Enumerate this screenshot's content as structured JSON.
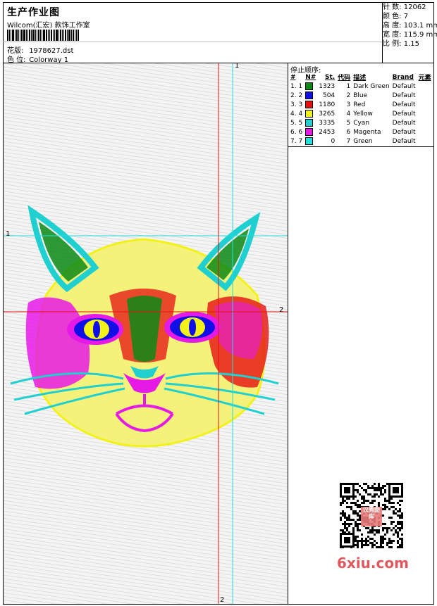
{
  "header": {
    "title": "生产作业图",
    "subtitle": "Wilcom(汇宏) 款饰工作室",
    "design_label": "花版:",
    "design_value": "1978627.dst",
    "colorway_label": "色 位:",
    "colorway_value": "Colorway 1"
  },
  "stats": {
    "stitches": "针 数:  12062",
    "colors": "颜 色:  7",
    "height": "高 度:  103.1 mm",
    "width": "宽 度:  115.9 mm",
    "scale": "比 例:  1.15"
  },
  "panel": {
    "title": "停止顺序:",
    "headers": [
      "#",
      "N#",
      "St.",
      "代码",
      "描述",
      "Brand",
      "元素"
    ],
    "rows": [
      {
        "idx": "1.",
        "n": "1",
        "color": "#0a8a14",
        "st": "1323",
        "code": "1",
        "desc": "Dark Green",
        "brand": "Default"
      },
      {
        "idx": "2.",
        "n": "2",
        "color": "#1010e6",
        "st": "504",
        "code": "2",
        "desc": "Blue",
        "brand": "Default"
      },
      {
        "idx": "3.",
        "n": "3",
        "color": "#e61010",
        "st": "1180",
        "code": "3",
        "desc": "Red",
        "brand": "Default"
      },
      {
        "idx": "4.",
        "n": "4",
        "color": "#f2f21a",
        "st": "3265",
        "code": "4",
        "desc": "Yellow",
        "brand": "Default"
      },
      {
        "idx": "5.",
        "n": "5",
        "color": "#20d0d0",
        "st": "3335",
        "code": "5",
        "desc": "Cyan",
        "brand": "Default"
      },
      {
        "idx": "6.",
        "n": "6",
        "color": "#e61ae6",
        "st": "2453",
        "code": "6",
        "desc": "Magenta",
        "brand": "Default"
      },
      {
        "idx": "7.",
        "n": "7",
        "color": "#20e0d8",
        "st": "0",
        "code": "7",
        "desc": "Green",
        "brand": "Default"
      }
    ]
  },
  "markers": {
    "cyan_top": "1",
    "cyan_left": "1",
    "red_right": "2",
    "red_bottom": "2"
  },
  "watermark": {
    "site": "6xiu.com",
    "stamp": "汉秀图库"
  },
  "colors": {
    "dark_green": "#0a8a14",
    "blue": "#1010e6",
    "red": "#e61010",
    "yellow": "#f2f21a",
    "cyan": "#20d0d0",
    "magenta": "#e61ae6"
  }
}
